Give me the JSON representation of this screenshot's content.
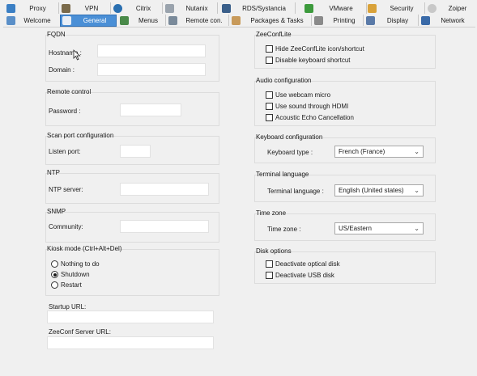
{
  "tabs_row1": [
    {
      "label": "Proxy",
      "icon": "proxy-icon"
    },
    {
      "label": "VPN",
      "icon": "vpn-icon"
    },
    {
      "label": "Citrix",
      "icon": "citrix-icon"
    },
    {
      "label": "Nutanix",
      "icon": "nutanix-icon"
    },
    {
      "label": "RDS/Systancia",
      "icon": "rds-icon"
    },
    {
      "label": "VMware",
      "icon": "vmware-icon"
    },
    {
      "label": "Security",
      "icon": "security-icon"
    },
    {
      "label": "Zoiper",
      "icon": "zoiper-icon"
    }
  ],
  "tabs_row2": [
    {
      "label": "Welcome",
      "icon": "welcome-icon"
    },
    {
      "label": "General",
      "icon": "general-icon",
      "active": true
    },
    {
      "label": "Menus",
      "icon": "menus-icon"
    },
    {
      "label": "Remote con.",
      "icon": "remote-icon"
    },
    {
      "label": "Packages & Tasks",
      "icon": "packages-icon"
    },
    {
      "label": "Printing",
      "icon": "printing-icon"
    },
    {
      "label": "Display",
      "icon": "display-icon"
    },
    {
      "label": "Network",
      "icon": "network-icon"
    }
  ],
  "fqdn": {
    "title": "FQDN",
    "hostname_label": "Hostname :",
    "domain_label": "Domain :"
  },
  "remote_control": {
    "title": "Remote control",
    "password_label": "Password :"
  },
  "scan_port": {
    "title": "Scan port configuration",
    "listen_port_label": "Listen port:"
  },
  "ntp": {
    "title": "NTP",
    "server_label": "NTP server:"
  },
  "snmp": {
    "title": "SNMP",
    "community_label": "Community:"
  },
  "kiosk": {
    "title": "Kiosk mode (Ctrl+Alt+Del)",
    "options": [
      "Nothing to do",
      "Shutdown",
      "Restart"
    ],
    "selected": "Shutdown"
  },
  "startup_url_label": "Startup URL:",
  "zeeconf_server_label": "ZeeConf Server URL:",
  "zeeconflite": {
    "title": "ZeeConfLite",
    "options": [
      "Hide ZeeConfLite icon/shortcut",
      "Disable keyboard shortcut"
    ]
  },
  "audio": {
    "title": "Audio configuration",
    "options": [
      "Use webcam micro",
      "Use sound through HDMI",
      "Acoustic Echo Cancellation"
    ]
  },
  "keyboard": {
    "title": "Keyboard configuration",
    "label": "Keyboard type :",
    "value": "French (France)"
  },
  "terminal_language": {
    "title": "Terminal language",
    "label": "Terminal language :",
    "value": "English (United states)"
  },
  "timezone": {
    "title": "Time zone",
    "label": "Time zone :",
    "value": "US/Eastern"
  },
  "disk": {
    "title": "Disk options",
    "options": [
      "Deactivate optical disk",
      "Deactivate USB disk"
    ]
  },
  "colors": {
    "active_tab": "#4a8fd6",
    "background": "#f0f0f0"
  }
}
